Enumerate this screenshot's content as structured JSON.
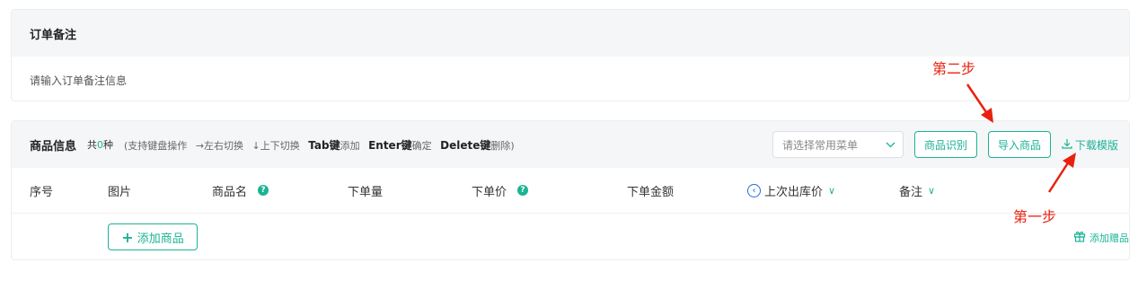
{
  "remark": {
    "title": "订单备注",
    "placeholder": "请输入订单备注信息"
  },
  "goods": {
    "title": "商品信息",
    "count_prefix": "共",
    "count": "0",
    "count_suffix": "种",
    "hint_open": "(支持键盘操作",
    "hint_arrow_lr": "→左右切换",
    "hint_arrow_ud": "↓上下切换",
    "hint_tab_key": "Tab键",
    "hint_tab_action": "添加",
    "hint_enter_key": "Enter键",
    "hint_enter_action": "确定",
    "hint_delete_key": "Delete键",
    "hint_delete_action": "删除)",
    "common_menu_placeholder": "请选择常用菜单",
    "recognize_button": "商品识别",
    "import_button": "导入商品",
    "download_template": "下载模版",
    "columns": {
      "index": "序号",
      "image": "图片",
      "name": "商品名",
      "quantity": "下单量",
      "price": "下单价",
      "amount": "下单金额",
      "last_price": "上次出库价",
      "remark": "备注"
    },
    "add_goods_button": "添加商品",
    "add_gift": "添加赠品"
  },
  "annotations": {
    "step1": "第一步",
    "step2": "第二步"
  },
  "colors": {
    "accent": "#1bb394",
    "annotation": "#e8210f",
    "header_bg": "#f5f6f8"
  }
}
